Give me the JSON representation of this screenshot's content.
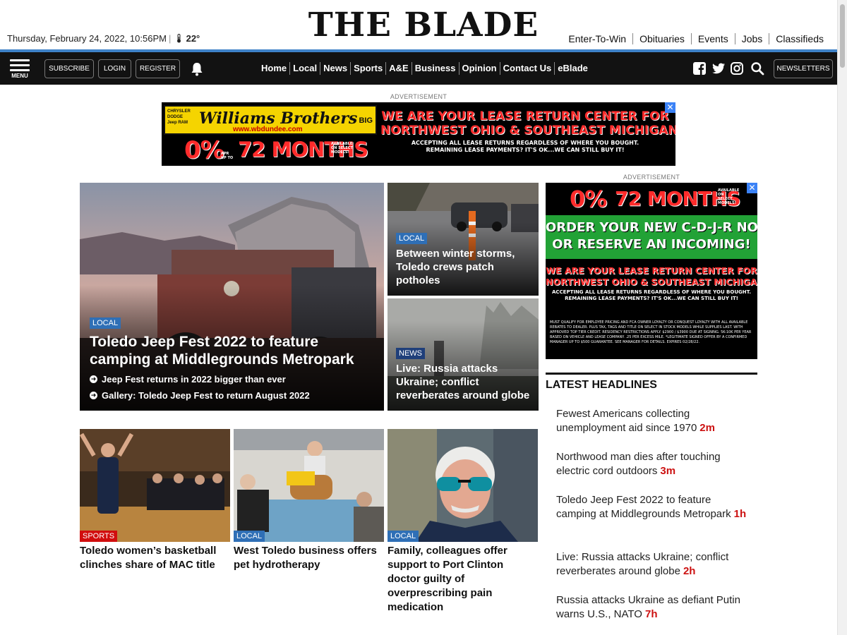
{
  "header": {
    "date": "Thursday, February 24, 2022, 10:56PM",
    "temperature": "22°",
    "logo": "THE BLADE",
    "top_links": [
      "Enter-To-Win",
      "Obituaries",
      "Events",
      "Jobs",
      "Classifieds"
    ]
  },
  "navbar": {
    "menu_label": "MENU",
    "subscribe": "SUBSCRIBE",
    "login": "LOGIN",
    "register": "REGISTER",
    "links": [
      "Home",
      "Local",
      "News",
      "Sports",
      "A&E",
      "Business",
      "Opinion",
      "Contact Us",
      "eBlade"
    ],
    "newsletters": "NEWSLETTERS"
  },
  "ads": {
    "label": "ADVERTISEMENT",
    "close": "✕",
    "banner": {
      "brand": "Williams Brothers",
      "url": "www.wbdundee.com",
      "brands_list": "CHRYSLER DODGE Jeep RAM",
      "big": "BIG",
      "rate": "0%",
      "months": "72 MONTHS",
      "rate_note": "APR UP TO",
      "months_note": "AVAILABLE ON SELECT MODELS!",
      "headline_1": "WE ARE YOUR LEASE RETURN CENTER FOR",
      "headline_2": "NORTHWEST OHIO & SOUTHEAST MICHIGAN!",
      "sub_1": "ACCEPTING ALL LEASE RETURNS REGARDLESS OF WHERE YOU BOUGHT.",
      "sub_2": "REMAINING LEASE PAYMENTS? IT'S OK...WE CAN STILL BUY IT!"
    },
    "side": {
      "rate": "0%",
      "months": "72 MONTHS",
      "months_note": "AVAILABLE ON SELECT MODELS!",
      "green_1": "ORDER YOUR NEW C-D-J-R NOW",
      "green_2": "OR RESERVE AN INCOMING!",
      "headline_1": "WE ARE YOUR LEASE RETURN CENTER FOR",
      "headline_2": "NORTHWEST OHIO & SOUTHEAST MICHIGAN!",
      "sub_1": "ACCEPTING ALL LEASE RETURNS REGARDLESS OF WHERE YOU BOUGHT.",
      "sub_2": "REMAINING LEASE PAYMENTS? IT'S OK...WE CAN STILL BUY IT!",
      "fine_print": "MUST QUALIFY FOR EMPLOYEE PRICING AND FCA OWNER LOYALTY OR CONQUEST LOYALTY WITH ALL AVAILABLE REBATES TO DEALER. PLUS TAX, TAGS AND TITLE ON SELECT IN STOCK MODELS WHILE SUPPLIES LAST. WITH APPROVED TOP TIER CREDIT. RESIDENCY RESTRICTIONS APPLY. $2900 / $3900 DUE AT SIGNING. 5K-10K PER YEAR BASED ON VEHICLE AND LEASE COMPANY. .25 PER EXCESS MILE. *LEGITIMATE SIGNED OFFER BY A CONFIRMED MANAGER UP TO $500 GUARANTEE. SEE MANAGER FOR DETAILS. EXPIRES 02/28/22."
    }
  },
  "hero": {
    "tag": "LOCAL",
    "title": "Toledo Jeep Fest 2022 to feature camping at Middlegrounds Metropark",
    "related": [
      "Jeep Fest returns in 2022 bigger than ever",
      "Gallery: Toledo Jeep Fest to return August 2022"
    ]
  },
  "side_stories": [
    {
      "tag": "LOCAL",
      "title": "Between winter storms, Toledo crews patch potholes"
    },
    {
      "tag": "NEWS",
      "title": "Live: Russia attacks Ukraine; conflict reverberates around globe"
    }
  ],
  "bottom_stories": [
    {
      "tag": "SPORTS",
      "title": "Toledo women’s basketball clinches share of MAC title"
    },
    {
      "tag": "LOCAL",
      "title": "West Toledo business offers pet hydrotherapy"
    },
    {
      "tag": "LOCAL",
      "title": "Family, colleagues offer support to Port Clinton doctor guilty of overprescribing pain medication"
    }
  ],
  "latest": {
    "heading": "LATEST HEADLINES",
    "items": [
      {
        "title": "Fewest Americans collecting unemployment aid since 1970",
        "age": "2m"
      },
      {
        "title": "Northwood man dies after touching electric cord outdoors",
        "age": "3m"
      },
      {
        "title": "Toledo Jeep Fest 2022 to feature camping at Middlegrounds Metropark",
        "age": "1h"
      },
      {
        "title": "Live: Russia attacks Ukraine; conflict reverberates around globe",
        "age": "2h"
      },
      {
        "title": "Russia attacks Ukraine as defiant Putin warns U.S., NATO",
        "age": "7h"
      }
    ]
  }
}
